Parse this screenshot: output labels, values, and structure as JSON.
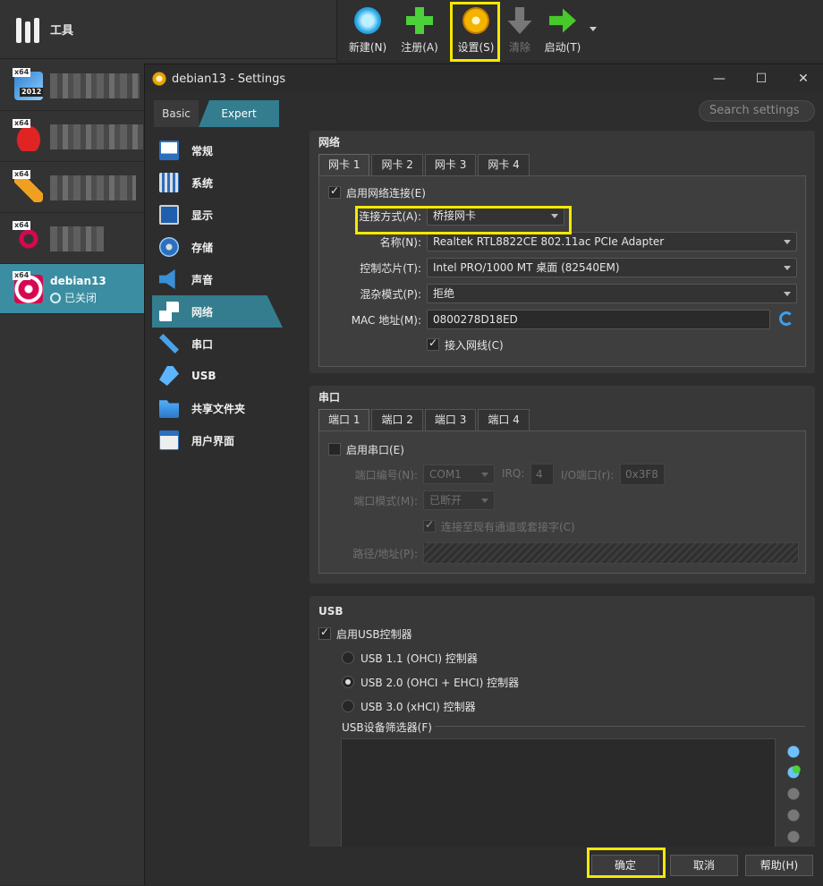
{
  "sidebar": {
    "tools_label": "工具",
    "vms": [
      {
        "badge": "x64",
        "extra": "2012"
      },
      {
        "badge": "x64"
      },
      {
        "badge": "x64"
      },
      {
        "badge": "x64"
      },
      {
        "badge": "x64",
        "name": "debian13",
        "state": "已关闭"
      }
    ]
  },
  "toolbar": {
    "new_label": "新建(N)",
    "register_label": "注册(A)",
    "settings_label": "设置(S)",
    "discard_label": "清除",
    "start_label": "启动(T)"
  },
  "dialog": {
    "title": "debian13 - Settings",
    "minimize": "—",
    "maximize": "☐",
    "close": "✕",
    "mode_basic": "Basic",
    "mode_expert": "Expert",
    "search_placeholder": "Search settings"
  },
  "nav": {
    "items": [
      {
        "label": "常规",
        "icon": "general-icon"
      },
      {
        "label": "系统",
        "icon": "system-icon"
      },
      {
        "label": "显示",
        "icon": "display-icon"
      },
      {
        "label": "存储",
        "icon": "storage-icon"
      },
      {
        "label": "声音",
        "icon": "audio-icon"
      },
      {
        "label": "网络",
        "icon": "network-icon",
        "active": true
      },
      {
        "label": "串口",
        "icon": "serial-icon"
      },
      {
        "label": "USB",
        "icon": "usb-icon"
      },
      {
        "label": "共享文件夹",
        "icon": "shared-folder-icon"
      },
      {
        "label": "用户界面",
        "icon": "user-interface-icon"
      }
    ]
  },
  "network": {
    "title": "网络",
    "tabs": [
      "网卡 1",
      "网卡 2",
      "网卡 3",
      "网卡 4"
    ],
    "enable_label": "启用网络连接(E)",
    "enable_checked": true,
    "attach_label": "连接方式(A):",
    "attach_value": "桥接网卡",
    "name_label": "名称(N):",
    "name_value": "Realtek RTL8822CE 802.11ac PCIe Adapter",
    "adapter_label": "控制芯片(T):",
    "adapter_value": "Intel PRO/1000 MT 桌面 (82540EM)",
    "promisc_label": "混杂模式(P):",
    "promisc_value": "拒绝",
    "mac_label": "MAC 地址(M):",
    "mac_value": "0800278D18ED",
    "cable_label": "接入网线(C)",
    "cable_checked": true
  },
  "serial": {
    "title": "串口",
    "tabs": [
      "端口 1",
      "端口 2",
      "端口 3",
      "端口 4"
    ],
    "enable_label": "启用串口(E)",
    "port_num_label": "端口编号(N):",
    "port_num_value": "COM1",
    "irq_label": "IRQ:",
    "irq_value": "4",
    "io_label": "I/O端口(r):",
    "io_value": "0x3F8",
    "mode_label": "端口模式(M):",
    "mode_value": "已断开",
    "connect_existing_label": "连接至现有通道或套接字(C)",
    "path_label": "路径/地址(P):"
  },
  "usb": {
    "title": "USB",
    "enable_label": "启用USB控制器",
    "enable_checked": true,
    "options": [
      {
        "label": "USB 1.1 (OHCI) 控制器",
        "selected": false
      },
      {
        "label": "USB 2.0 (OHCI + EHCI) 控制器",
        "selected": true
      },
      {
        "label": "USB 3.0 (xHCI) 控制器",
        "selected": false
      }
    ],
    "filters_label": "USB设备筛选器(F)"
  },
  "buttons": {
    "ok": "确定",
    "cancel": "取消",
    "help": "帮助(H)"
  },
  "colors": {
    "accent": "#337d8f",
    "highlight": "#f5e900",
    "selected_vm": "#3b8ea1"
  }
}
